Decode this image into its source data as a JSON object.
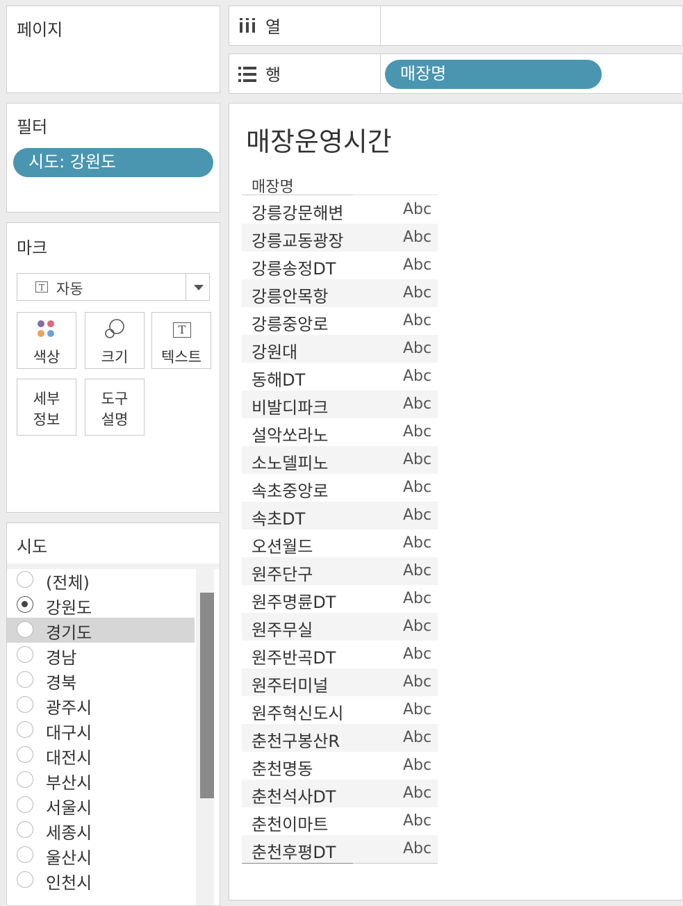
{
  "pages_card": {
    "title": "페이지"
  },
  "columns_shelf": {
    "label": "열",
    "icon": "columns-icon"
  },
  "rows_shelf": {
    "label": "행",
    "icon": "rows-icon",
    "pill": "매장명"
  },
  "filters_card": {
    "title": "필터",
    "pill": "시도: 강원도"
  },
  "marks_card": {
    "title": "마크",
    "mark_type": "자동",
    "buttons": {
      "color": "색상",
      "size": "크기",
      "text": "텍스트",
      "detail_line1": "세부",
      "detail_line2": "정보",
      "tooltip_line1": "도구",
      "tooltip_line2": "설명"
    }
  },
  "sido_filter": {
    "title": "시도",
    "options": [
      {
        "label": "(전체)",
        "selected": false
      },
      {
        "label": "강원도",
        "selected": true
      },
      {
        "label": "경기도",
        "selected": false,
        "hover": true
      },
      {
        "label": "경남",
        "selected": false
      },
      {
        "label": "경북",
        "selected": false
      },
      {
        "label": "광주시",
        "selected": false
      },
      {
        "label": "대구시",
        "selected": false
      },
      {
        "label": "대전시",
        "selected": false
      },
      {
        "label": "부산시",
        "selected": false
      },
      {
        "label": "서울시",
        "selected": false
      },
      {
        "label": "세종시",
        "selected": false
      },
      {
        "label": "울산시",
        "selected": false
      },
      {
        "label": "인천시",
        "selected": false
      }
    ]
  },
  "worksheet": {
    "title": "매장운영시간",
    "column_header": "매장명",
    "rows": [
      {
        "name": "강릉강문해변",
        "value": "Abc"
      },
      {
        "name": "강릉교동광장",
        "value": "Abc"
      },
      {
        "name": "강릉송정DT",
        "value": "Abc"
      },
      {
        "name": "강릉안목항",
        "value": "Abc"
      },
      {
        "name": "강릉중앙로",
        "value": "Abc"
      },
      {
        "name": "강원대",
        "value": "Abc"
      },
      {
        "name": "동해DT",
        "value": "Abc"
      },
      {
        "name": "비발디파크",
        "value": "Abc"
      },
      {
        "name": "설악쏘라노",
        "value": "Abc"
      },
      {
        "name": "소노델피노",
        "value": "Abc"
      },
      {
        "name": "속초중앙로",
        "value": "Abc"
      },
      {
        "name": "속초DT",
        "value": "Abc"
      },
      {
        "name": "오션월드",
        "value": "Abc"
      },
      {
        "name": "원주단구",
        "value": "Abc"
      },
      {
        "name": "원주명륜DT",
        "value": "Abc"
      },
      {
        "name": "원주무실",
        "value": "Abc"
      },
      {
        "name": "원주반곡DT",
        "value": "Abc"
      },
      {
        "name": "원주터미널",
        "value": "Abc"
      },
      {
        "name": "원주혁신도시",
        "value": "Abc"
      },
      {
        "name": "춘천구봉산R",
        "value": "Abc"
      },
      {
        "name": "춘천명동",
        "value": "Abc"
      },
      {
        "name": "춘천석사DT",
        "value": "Abc"
      },
      {
        "name": "춘천이마트",
        "value": "Abc"
      },
      {
        "name": "춘천후평DT",
        "value": "Abc"
      }
    ]
  },
  "colors": {
    "pill": "#4a96b1",
    "panel_bg": "#ececec"
  }
}
